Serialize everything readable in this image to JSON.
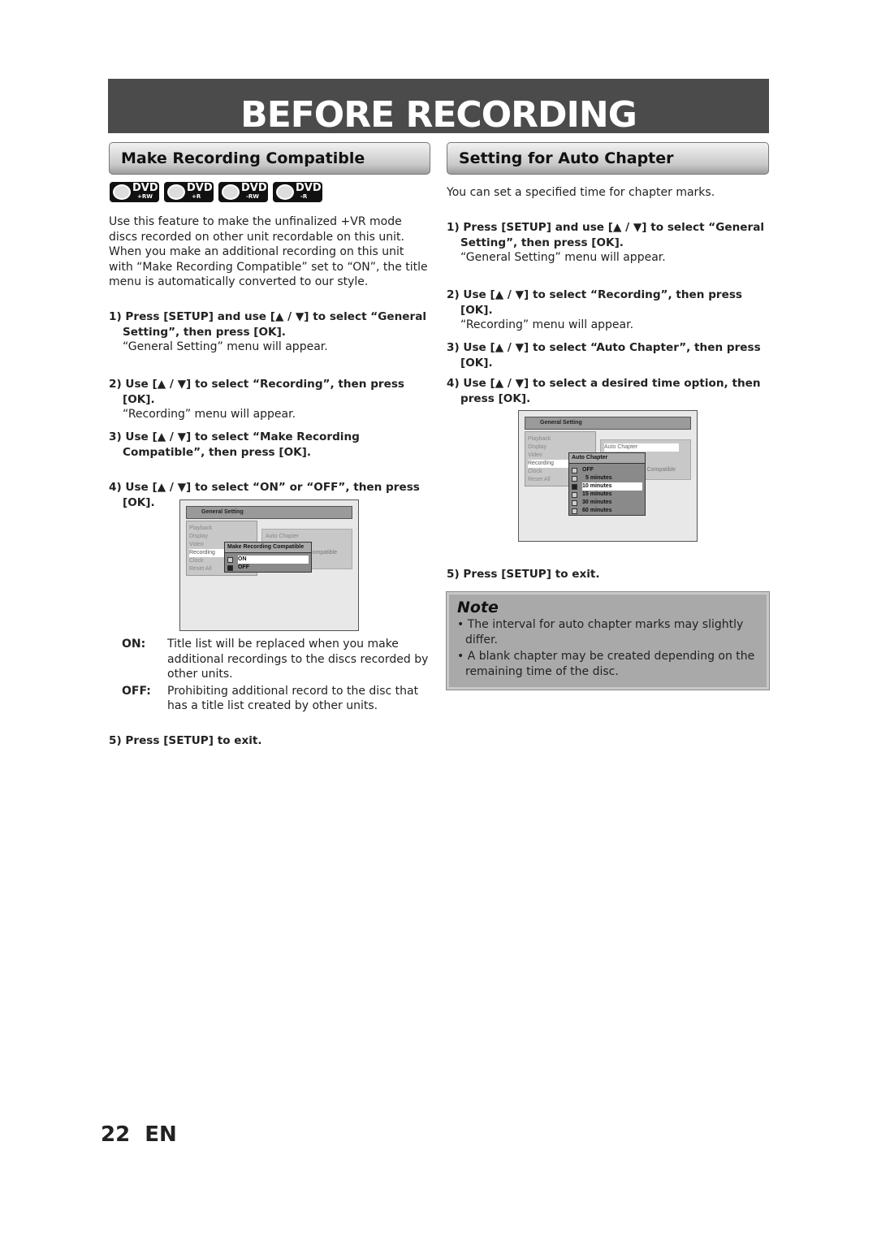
{
  "title": "BEFORE RECORDING",
  "left": {
    "heading": "Make Recording Compatible",
    "disc_badges": [
      {
        "label": "DVD",
        "sub": "+RW"
      },
      {
        "label": "DVD",
        "sub": "+R"
      },
      {
        "label": "DVD",
        "sub": "-RW"
      },
      {
        "label": "DVD",
        "sub": "-R"
      }
    ],
    "intro": "Use this feature to make the unfinalized +VR mode discs recorded on other unit recordable on this unit. When you make an additional recording on this unit with “Make Recording Compatible” set to “ON”, the title menu is automatically converted to our style.",
    "steps": [
      {
        "text": "1) Press [SETUP] and use [▲ / ▼] to select “General Setting”, then press [OK].",
        "sub": "“General Setting” menu will appear."
      },
      {
        "text": "2) Use [▲ / ▼] to select “Recording”, then press [OK].",
        "sub": "“Recording” menu will appear."
      },
      {
        "text": "3) Use [▲ / ▼] to select “Make Recording Compatible”, then press [OK].",
        "sub": ""
      },
      {
        "text": "4) Use [▲ / ▼] to select “ON” or “OFF”, then press [OK].",
        "sub": ""
      }
    ],
    "menu": {
      "header": "General Setting",
      "items": [
        "Playback",
        "Display",
        "Video",
        "Recording",
        "Clock",
        "Reset All"
      ],
      "right_items": [
        "Auto Chapter",
        "Compatible"
      ],
      "popup_title": "Make Recording Compatible",
      "options": [
        {
          "label": "ON",
          "checked": false,
          "highlighted": true
        },
        {
          "label": "OFF",
          "checked": true,
          "highlighted": false
        }
      ]
    },
    "defs": [
      {
        "term": "ON:",
        "desc": "Title list will be replaced when you make additional recordings to the discs recorded by other units."
      },
      {
        "term": "OFF:",
        "desc": "Prohibiting additional record to the disc that has a title list created by other units."
      }
    ],
    "step5": "5) Press [SETUP] to exit."
  },
  "right": {
    "heading": "Setting for Auto Chapter",
    "intro": "You can set a specified time for chapter marks.",
    "steps": [
      {
        "text": "1) Press [SETUP] and use [▲ / ▼] to select “General Setting”, then press [OK].",
        "sub": "“General Setting” menu will appear."
      },
      {
        "text": "2) Use [▲ / ▼] to select “Recording”, then press [OK].",
        "sub": "“Recording” menu will appear."
      },
      {
        "text": "3) Use [▲ / ▼] to select “Auto Chapter”, then press [OK].",
        "sub": ""
      },
      {
        "text": "4) Use [▲ / ▼] to select a desired time option, then press [OK].",
        "sub": ""
      }
    ],
    "menu": {
      "header": "General Setting",
      "items": [
        "Playback",
        "Display",
        "Video",
        "Recording",
        "Clock",
        "Reset All"
      ],
      "right_items": [
        "Auto Chapter",
        "Compatible"
      ],
      "popup_title": "Auto Chapter",
      "options": [
        {
          "label": "OFF",
          "checked": false,
          "highlighted": false
        },
        {
          "label": "5 minutes",
          "checked": false,
          "highlighted": false
        },
        {
          "label": "10 minutes",
          "checked": true,
          "highlighted": true
        },
        {
          "label": "15 minutes",
          "checked": false,
          "highlighted": false
        },
        {
          "label": "30 minutes",
          "checked": false,
          "highlighted": false
        },
        {
          "label": "60 minutes",
          "checked": false,
          "highlighted": false
        }
      ]
    },
    "step5": "5) Press [SETUP] to exit.",
    "note": {
      "title": "Note",
      "items": [
        "The interval for auto chapter marks may slightly differ.",
        "A blank chapter may be created depending on the remaining time of the disc."
      ]
    }
  },
  "footer": {
    "page": "22",
    "lang": "EN"
  }
}
